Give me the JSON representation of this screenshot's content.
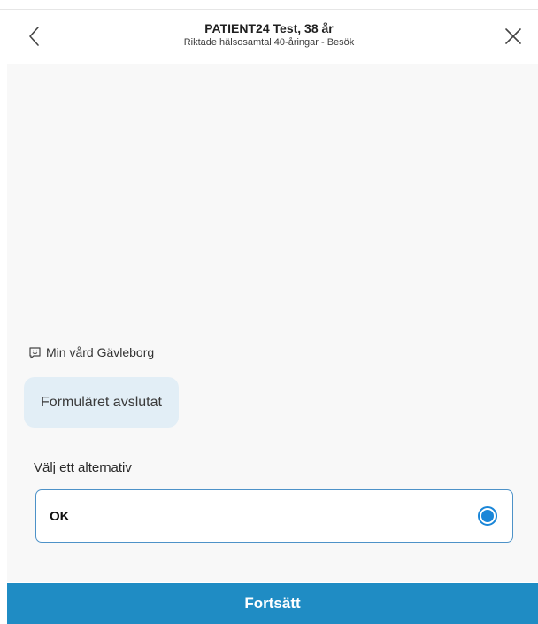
{
  "header": {
    "title": "PATIENT24 Test, 38 år",
    "subtitle": "Riktade hälsosamtal 40-åringar - Besök",
    "back_icon": "chevron-left-icon",
    "close_icon": "close-icon"
  },
  "chat": {
    "sender_icon": "chat-smiley-icon",
    "sender_name": "Min vård Gävleborg",
    "message": "Formuläret avslutat"
  },
  "choice": {
    "label": "Välj ett alternativ",
    "options": [
      {
        "label": "OK",
        "selected": true
      }
    ]
  },
  "footer": {
    "continue_label": "Fortsätt"
  },
  "colors": {
    "accent": "#1a86d8",
    "footer_button": "#1f8cc4",
    "bubble": "#e2eef6",
    "content_bg": "#f8f8f8"
  }
}
